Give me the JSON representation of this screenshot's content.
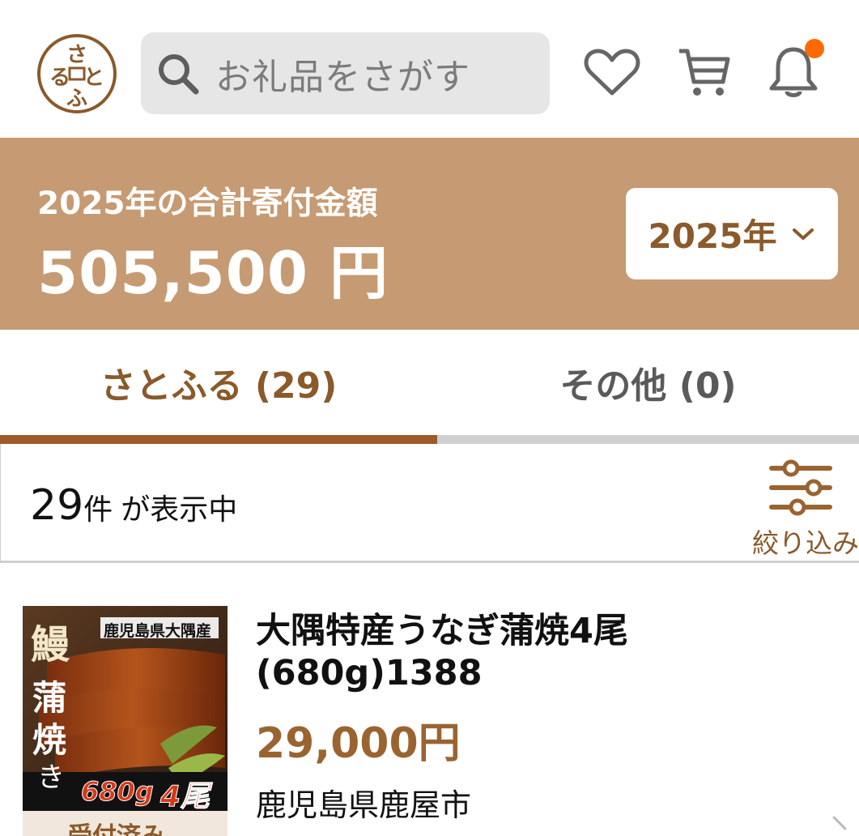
{
  "header": {
    "logo_text": "さとふる",
    "search_placeholder": "お礼品をさがす",
    "icons": [
      "logo-icon",
      "search-icon",
      "heart-icon",
      "cart-icon",
      "bell-icon"
    ],
    "has_notification": true
  },
  "summary": {
    "label": "2025年の合計寄付金額",
    "amount": "505,500 円",
    "year_select": "2025年"
  },
  "tabs": [
    {
      "label": "さとふる (29)",
      "active": true
    },
    {
      "label": "その他 (0)",
      "active": false
    }
  ],
  "results": {
    "count": "29",
    "unit": "件",
    "suffix": "が表示中",
    "filter_label": "絞り込み"
  },
  "items": [
    {
      "title": "大隅特産うなぎ蒲焼4尾(680g)1388",
      "price": "29,000円",
      "location": "鹿児島県鹿屋市",
      "thumb_text": {
        "region": "鹿児島県大隅産",
        "kanji_top": "鰻",
        "kanji_mid1": "蒲",
        "kanji_mid2": "焼",
        "kana": "き",
        "weight": "680g",
        "count": "4尾"
      },
      "status_badge": "受付済み"
    }
  ],
  "colors": {
    "brand_brown": "#c69a72",
    "accent_dark": "#8a5a2b",
    "tab_active_bar": "#9b5c2a",
    "notification": "#ff6a00"
  }
}
